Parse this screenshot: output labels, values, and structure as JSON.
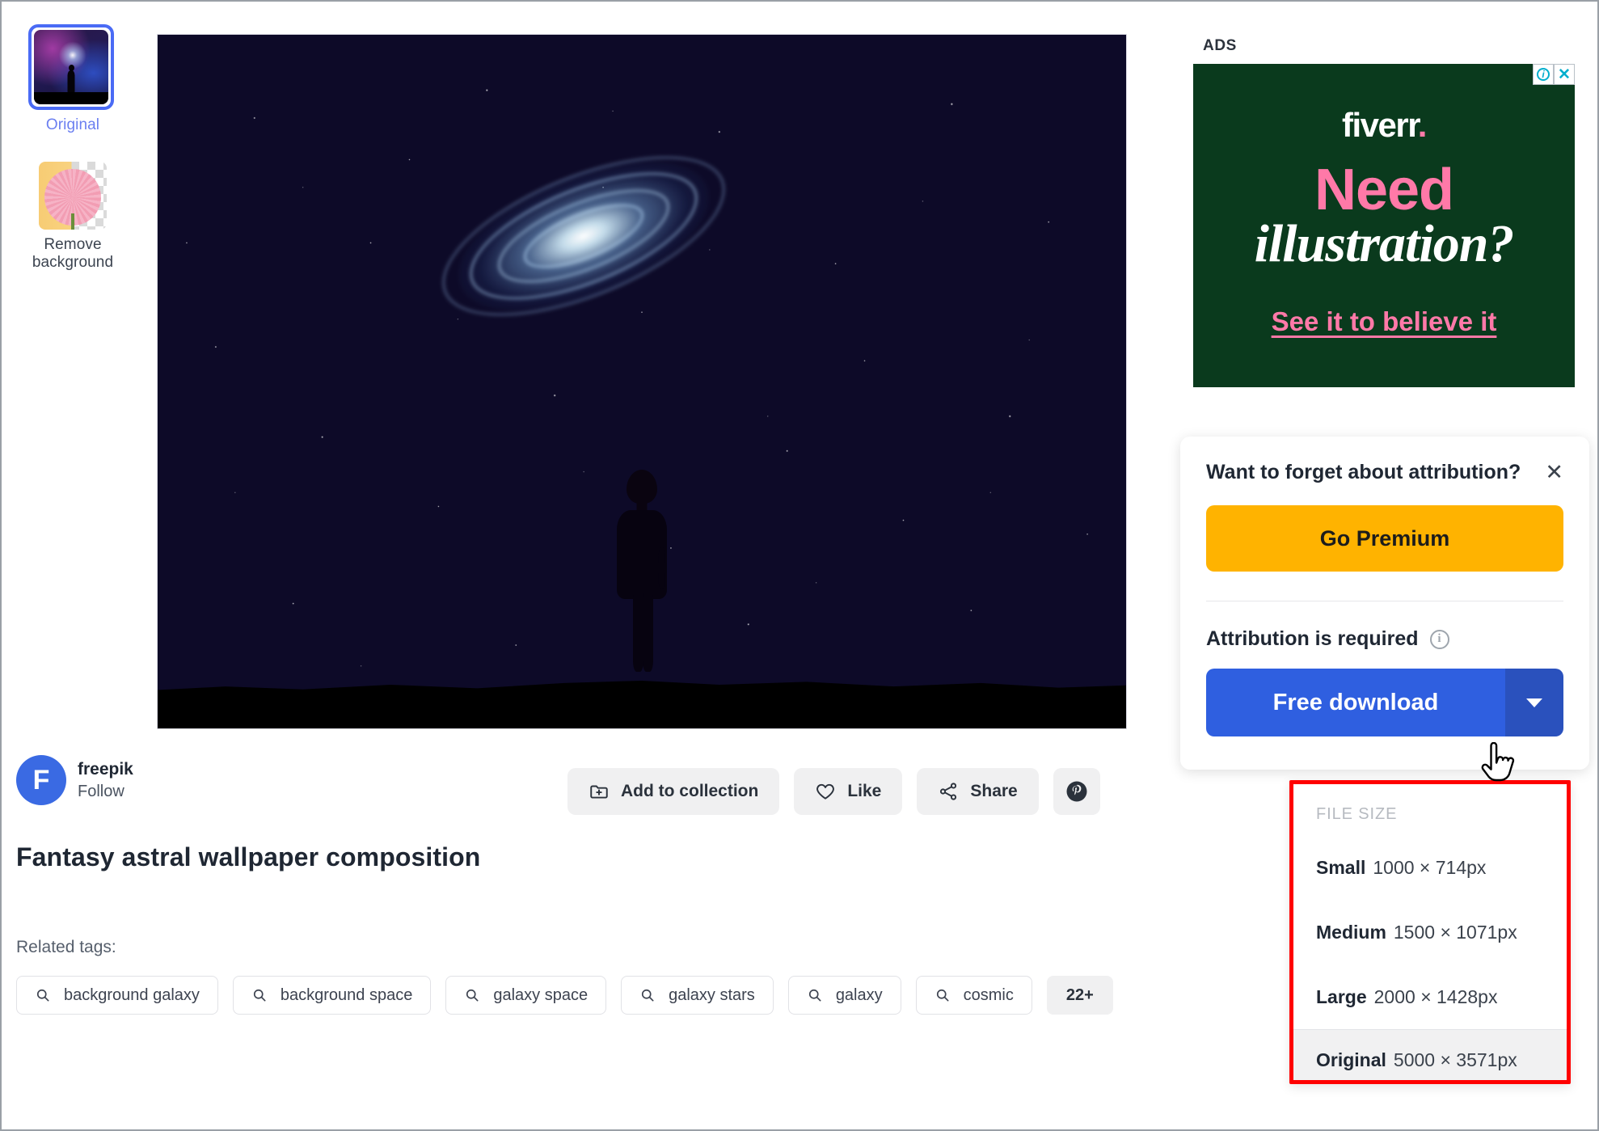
{
  "sidebar": {
    "items": [
      {
        "label": "Original",
        "icon": "image-thumbnail",
        "selected": true
      },
      {
        "label": "Remove background",
        "icon": "flower-thumbnail",
        "selected": false
      }
    ]
  },
  "hero": {
    "alt": "Fantasy astral wallpaper composition"
  },
  "author": {
    "avatar_initial": "F",
    "name": "freepik",
    "follow_label": "Follow"
  },
  "actions": [
    {
      "label": "Add to collection",
      "icon": "add-to-collection-icon"
    },
    {
      "label": "Like",
      "icon": "heart-icon"
    },
    {
      "label": "Share",
      "icon": "share-icon"
    },
    {
      "label": "",
      "icon": "pinterest-icon"
    }
  ],
  "page_title": "Fantasy astral wallpaper composition",
  "related": {
    "label": "Related tags:",
    "tags": [
      "background galaxy",
      "background space",
      "galaxy space",
      "galaxy stars",
      "galaxy",
      "cosmic"
    ],
    "more_label": "22+",
    "search_icon": "search-icon"
  },
  "ad": {
    "label": "ADS",
    "brand": "fiverr",
    "brand_dot": ".",
    "line1": "Need",
    "line2": "illustration?",
    "cta": "See it to believe it",
    "info_glyph": "i",
    "close_glyph": "✕",
    "bg_color": "#0a3a1d",
    "accent_color": "#ff79a8"
  },
  "attribution": {
    "title": "Want to forget about attribution?",
    "close_glyph": "✕",
    "premium_label": "Go Premium",
    "premium_color": "#ffb300",
    "required_label": "Attribution is required",
    "info_glyph": "i",
    "download_label": "Free download",
    "download_color": "#2f5fe0",
    "caret_icon": "chevron-down-icon"
  },
  "file_size": {
    "header": "FILE SIZE",
    "highlight_color": "#ff0000",
    "options": [
      {
        "name": "Small",
        "dims": "1000 × 714px",
        "selected": false
      },
      {
        "name": "Medium",
        "dims": "1500 × 1071px",
        "selected": false
      },
      {
        "name": "Large",
        "dims": "2000 × 1428px",
        "selected": false
      },
      {
        "name": "Original",
        "dims": "5000 × 3571px",
        "selected": true
      }
    ]
  }
}
